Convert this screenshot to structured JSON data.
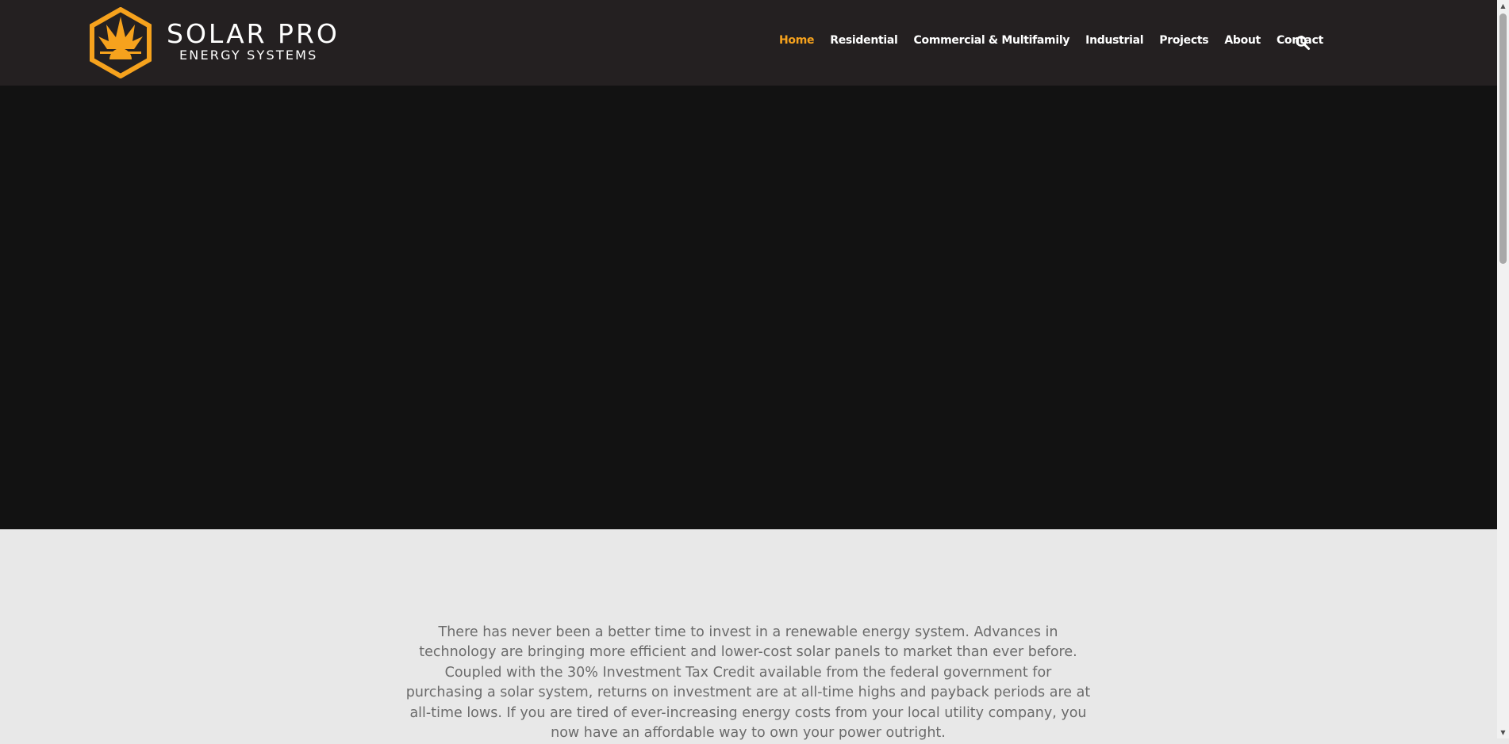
{
  "brand": {
    "name": "SOLAR PRO",
    "tagline": "ENERGY SYSTEMS",
    "logo_icon": "hexagon-sun-icon",
    "accent_color": "#f6a21d"
  },
  "nav": {
    "items": [
      {
        "label": "Home",
        "active": true
      },
      {
        "label": "Residential",
        "active": false
      },
      {
        "label": "Commercial & Multifamily",
        "active": false
      },
      {
        "label": "Industrial",
        "active": false
      },
      {
        "label": "Projects",
        "active": false
      },
      {
        "label": "About",
        "active": false
      },
      {
        "label": "Contact",
        "active": false
      }
    ],
    "search_icon": "search-icon"
  },
  "intro": {
    "text": "There has never been a better time to invest in a renewable energy system. Advances in technology are bringing more efficient and lower-cost solar panels to market than ever before. Coupled with the 30% Investment Tax Credit available from the federal government for purchasing a solar system, returns on investment are at all-time highs and payback periods are at all-time lows. If you are tired of ever-increasing energy costs from your local utility company, you now have an affordable way to own your power outright."
  },
  "colors": {
    "header_bg": "#242021",
    "hero_bg": "#121212",
    "page_bg": "#e8e8e8",
    "body_text": "#6b6b6b"
  }
}
